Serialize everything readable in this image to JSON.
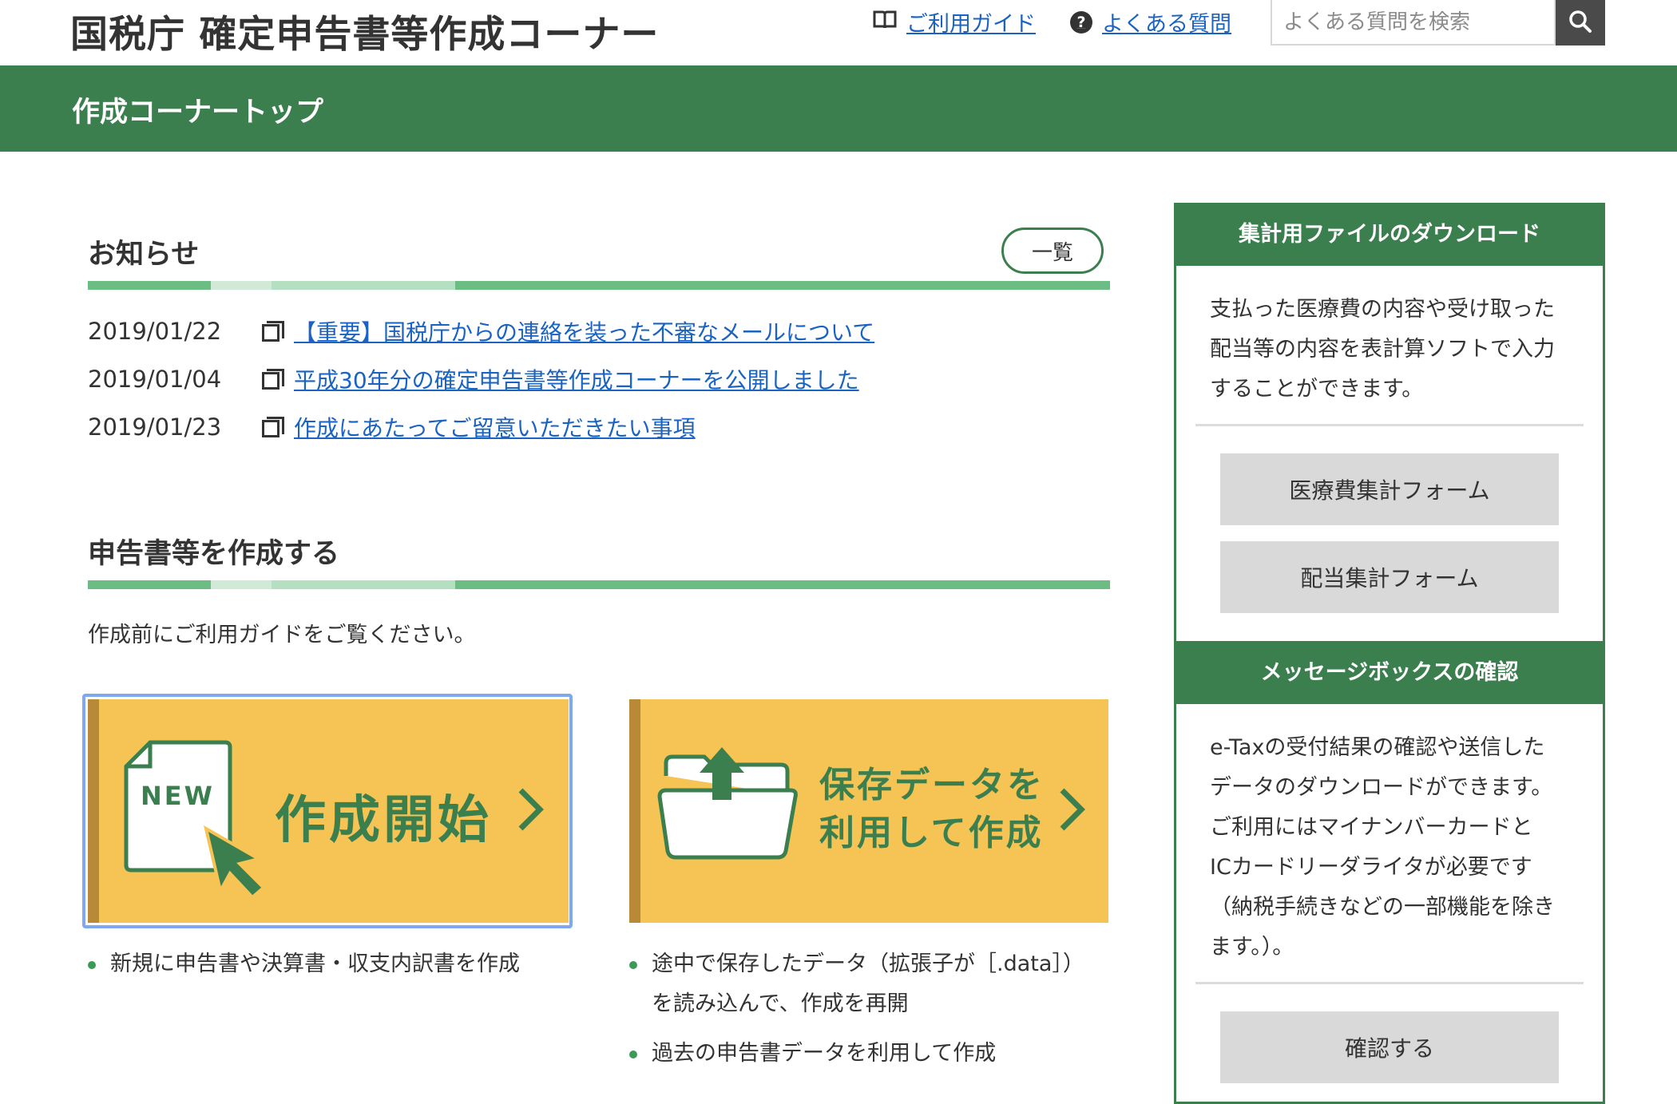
{
  "header": {
    "site_title": "国税庁 確定申告書等作成コーナー",
    "guide_link": "ご利用ガイド",
    "faq_link": "よくある質問",
    "search_placeholder": "よくある質問を検索"
  },
  "page_bar": {
    "title": "作成コーナートップ"
  },
  "news": {
    "title": "お知らせ",
    "list_button": "一覧",
    "items": [
      {
        "date": "2019/01/22",
        "text": "【重要】国税庁からの連絡を装った不審なメールについて"
      },
      {
        "date": "2019/01/04",
        "text": "平成30年分の確定申告書等作成コーナーを公開しました"
      },
      {
        "date": "2019/01/23",
        "text": "作成にあたってご留意いただきたい事項"
      }
    ]
  },
  "create": {
    "title": "申告書等を作成する",
    "intro": "作成前にご利用ガイドをご覧ください。",
    "new_card": {
      "badge": "NEW",
      "label": "作成開始",
      "bullets": [
        "新規に申告書や決算書・収支内訳書を作成"
      ]
    },
    "saved_card": {
      "label_line1": "保存データを",
      "label_line2": "利用して作成",
      "bullets": [
        "途中で保存したデータ（拡張子が［.data］）",
        "を読み込んで、作成を再開",
        "過去の申告書データを利用して作成"
      ]
    }
  },
  "sidebar": {
    "download": {
      "title": "集計用ファイルのダウンロード",
      "desc_lines": [
        "支払った医療費の内容や受け取った",
        "配当等の内容を表計算ソフトで入力",
        "することができます。"
      ],
      "medical_button": "医療費集計フォーム",
      "dividend_button": "配当集計フォーム"
    },
    "messagebox": {
      "title": "メッセージボックスの確認",
      "desc_lines": [
        "e-Taxの受付結果の確認や送信した",
        "データのダウンロードができます。",
        "ご利用にはマイナンバーカードと",
        "ICカードリーダライタが必要です",
        "（納税手続きなどの一部機能を除き",
        "ます。）。"
      ],
      "confirm_button": "確認する"
    }
  },
  "colors": {
    "green": "#3b7f4f",
    "light_green": "#6cbd83",
    "card_yellow": "#f6c355",
    "link": "#1a63c2"
  }
}
